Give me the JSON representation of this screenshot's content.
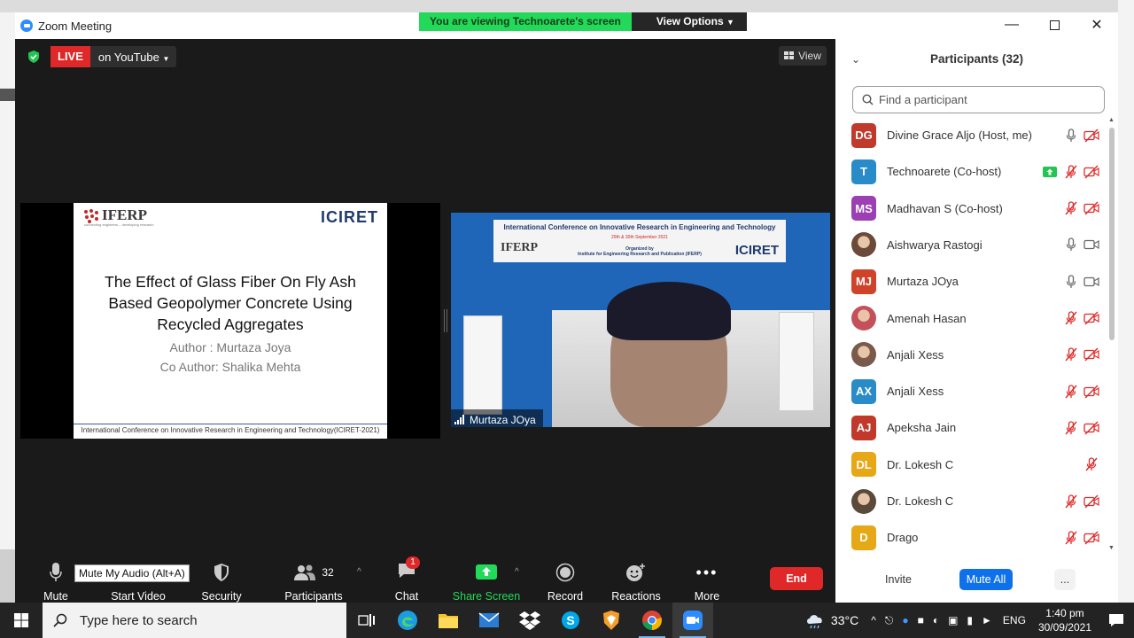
{
  "window": {
    "title": "Zoom Meeting"
  },
  "share_banner": {
    "viewing_text": "You are viewing Technoarete's screen",
    "view_options": "View Options"
  },
  "stage": {
    "live_label": "LIVE",
    "live_platform": "on YouTube",
    "view_label": "View"
  },
  "slide": {
    "logo_main": "IFERP",
    "logo_tagline": "connecting engineers... developing research",
    "conf_logo": "ICIRET",
    "title": "The Effect of Glass Fiber On Fly Ash Based Geopolymer Concrete Using Recycled Aggregates",
    "author": "Author : Murtaza Joya",
    "co_author": "Co Author: Shalika Mehta",
    "footer": "International Conference on Innovative Research in Engineering and Technology(ICIRET-2021)"
  },
  "video": {
    "banner_line1": "International Conference on Innovative Research in Engineering and Technology",
    "banner_dates": "29th & 30th September 2021",
    "banner_logo": "IFERP",
    "banner_org": "Organized by\nInstitute for Engineering Research and Publication (IFERP)",
    "banner_conf": "ICIRET",
    "participant_name": "Murtaza JOya"
  },
  "toolbar": {
    "mute": "Mute",
    "mute_tooltip": "Mute My Audio (Alt+A)",
    "start_video": "Start Video",
    "security": "Security",
    "participants": "Participants",
    "participants_count": "32",
    "chat": "Chat",
    "chat_badge": "1",
    "share_screen": "Share Screen",
    "record": "Record",
    "reactions": "Reactions",
    "more": "More",
    "end": "End"
  },
  "panel": {
    "title": "Participants (32)",
    "search_placeholder": "Find a participant",
    "participants": [
      {
        "initials": "DG",
        "name": "Divine Grace Aljo (Host, me)",
        "color": "#c0392b",
        "photo": false,
        "mic": "on",
        "video": "off",
        "sharing": false
      },
      {
        "initials": "T",
        "name": "Technoarete (Co-host)",
        "color": "#2a8bc9",
        "photo": false,
        "mic": "muted",
        "video": "off",
        "sharing": true
      },
      {
        "initials": "MS",
        "name": "Madhavan S (Co-host)",
        "color": "#9b3fb3",
        "photo": false,
        "mic": "muted",
        "video": "off",
        "sharing": false
      },
      {
        "initials": "",
        "name": "Aishwarya Rastogi",
        "color": "#6b4a3a",
        "photo": true,
        "mic": "on",
        "video": "on",
        "sharing": false
      },
      {
        "initials": "MJ",
        "name": "Murtaza JOya",
        "color": "#d0432b",
        "photo": false,
        "mic": "on",
        "video": "on",
        "sharing": false
      },
      {
        "initials": "",
        "name": "Amenah Hasan",
        "color": "#c4505c",
        "photo": true,
        "mic": "muted",
        "video": "off",
        "sharing": false
      },
      {
        "initials": "",
        "name": "Anjali Xess",
        "color": "#7a5a4a",
        "photo": true,
        "mic": "muted",
        "video": "off",
        "sharing": false
      },
      {
        "initials": "AX",
        "name": "Anjali Xess",
        "color": "#2a8bc9",
        "photo": false,
        "mic": "muted",
        "video": "off",
        "sharing": false
      },
      {
        "initials": "AJ",
        "name": "Apeksha Jain",
        "color": "#c0392b",
        "photo": false,
        "mic": "muted",
        "video": "off",
        "sharing": false
      },
      {
        "initials": "DL",
        "name": "Dr. Lokesh C",
        "color": "#e6a817",
        "photo": false,
        "mic": "muted",
        "video": "none",
        "sharing": false
      },
      {
        "initials": "",
        "name": "Dr. Lokesh C",
        "color": "#5a4a3a",
        "photo": true,
        "mic": "muted",
        "video": "off",
        "sharing": false
      },
      {
        "initials": "D",
        "name": "Drago",
        "color": "#e6a817",
        "photo": false,
        "mic": "muted",
        "video": "off",
        "sharing": false
      }
    ],
    "invite": "Invite",
    "mute_all": "Mute All",
    "more": "..."
  },
  "taskbar": {
    "search_placeholder": "Type here to search",
    "temperature": "33°C",
    "language": "ENG",
    "time": "1:40 pm",
    "date": "30/09/2021"
  },
  "colors": {
    "zoom_blue": "#2d8cff",
    "live_red": "#e02828",
    "share_green": "#23d959",
    "muted_red": "#e02828"
  }
}
